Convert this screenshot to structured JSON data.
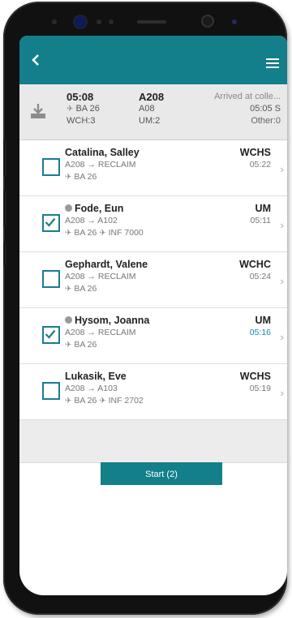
{
  "appbar": {
    "back_icon": "chevron-left-icon",
    "menu_icon": "hamburger-menu-icon"
  },
  "flight": {
    "time": "05:08",
    "flight_no": "BA 26",
    "wch": "WCH:3",
    "gate": "A208",
    "stand": "A08",
    "um": "UM:2",
    "status": "Arrived at colle...",
    "status_time": "05:05 S",
    "other": "Other:0"
  },
  "passengers": [
    {
      "name": "Catalina, Salley",
      "route_from": "A208",
      "route_to": "RECLAIM",
      "flight": "BA 26",
      "extra": "",
      "code": "WCHS",
      "time": "05:22",
      "checked": false,
      "dot": false,
      "time_alert": false
    },
    {
      "name": "Fode, Eun",
      "route_from": "A208",
      "route_to": "A102",
      "flight": "BA 26",
      "extra": "INF 7000",
      "code": "UM",
      "time": "05:11",
      "checked": true,
      "dot": true,
      "time_alert": false
    },
    {
      "name": "Gephardt, Valene",
      "route_from": "A208",
      "route_to": "RECLAIM",
      "flight": "BA 26",
      "extra": "",
      "code": "WCHC",
      "time": "05:24",
      "checked": false,
      "dot": false,
      "time_alert": false
    },
    {
      "name": "Hysom, Joanna",
      "route_from": "A208",
      "route_to": "RECLAIM",
      "flight": "BA 26",
      "extra": "",
      "code": "UM",
      "time": "05:16",
      "checked": true,
      "dot": true,
      "time_alert": true
    },
    {
      "name": "Lukasik, Eve",
      "route_from": "A208",
      "route_to": "A103",
      "flight": "BA 26",
      "extra": "INF 2702",
      "code": "WCHS",
      "time": "05:19",
      "checked": false,
      "dot": false,
      "time_alert": false
    }
  ],
  "start_button": {
    "label": "Start (2)"
  },
  "colors": {
    "accent": "#137f8a",
    "alert_time": "#1a86b8"
  }
}
